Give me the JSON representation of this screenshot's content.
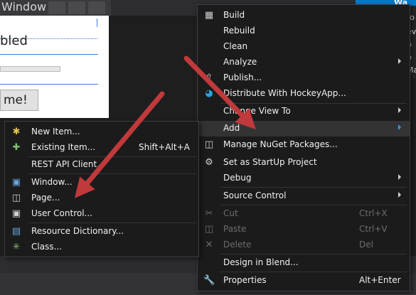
{
  "designer": {
    "title": "Window",
    "enabled_text": "bled",
    "button_text": "me!"
  },
  "solution_explorer": {
    "header": "Wa",
    "items": [
      "ro",
      "ev",
      "p",
      "p",
      "Ma"
    ]
  },
  "context_menu": {
    "items": [
      {
        "label": "Build",
        "icon": "build-icon"
      },
      {
        "label": "Rebuild"
      },
      {
        "label": "Clean"
      },
      {
        "label": "Analyze",
        "submenu": true
      },
      {
        "label": "Publish...",
        "icon": "publish-icon"
      },
      {
        "label": "Distribute With HockeyApp...",
        "icon": "hockeyapp-icon"
      },
      {
        "label": "Change View To",
        "submenu": true
      },
      {
        "label": "Add",
        "submenu": true,
        "highlighted": true
      },
      {
        "label": "Manage NuGet Packages...",
        "icon": "nuget-icon"
      },
      {
        "label": "Set as StartUp Project",
        "icon": "gear-icon"
      },
      {
        "label": "Debug",
        "submenu": true
      },
      {
        "label": "Source Control",
        "submenu": true
      },
      {
        "label": "Cut",
        "shortcut": "Ctrl+X",
        "disabled": true,
        "icon": "scissors-icon"
      },
      {
        "label": "Paste",
        "shortcut": "Ctrl+V",
        "disabled": true,
        "icon": "paste-icon"
      },
      {
        "label": "Delete",
        "shortcut": "Del",
        "disabled": true,
        "icon": "delete-icon"
      },
      {
        "label": "Design in Blend..."
      },
      {
        "label": "Properties",
        "shortcut": "Alt+Enter",
        "icon": "wrench-icon"
      }
    ]
  },
  "add_submenu": {
    "items": [
      {
        "label": "New Item...",
        "icon": "new-item-icon"
      },
      {
        "label": "Existing Item...",
        "shortcut": "Shift+Alt+A",
        "icon": "existing-item-icon"
      },
      {
        "label": "REST API Client..."
      },
      {
        "label": "Window...",
        "icon": "window-icon"
      },
      {
        "label": "Page...",
        "icon": "page-icon"
      },
      {
        "label": "User Control...",
        "icon": "user-control-icon"
      },
      {
        "label": "Resource Dictionary...",
        "icon": "resource-dictionary-icon"
      },
      {
        "label": "Class...",
        "icon": "class-icon"
      }
    ]
  },
  "colors": {
    "menu_bg": "#1b1b1c",
    "highlight": "#333334",
    "accent": "#3399ff",
    "arrow": "#c0393b"
  }
}
